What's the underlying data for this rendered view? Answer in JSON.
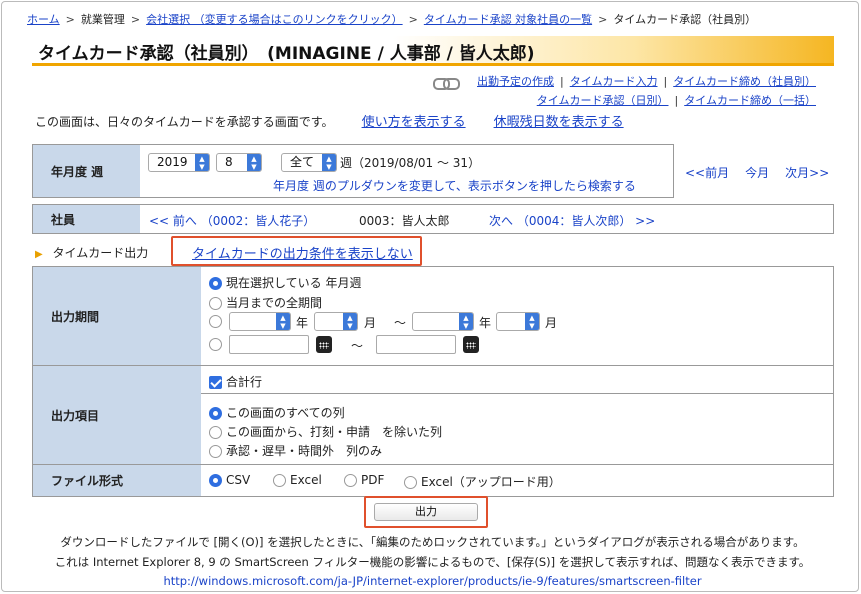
{
  "breadcrumb": {
    "home": "ホーム",
    "work": "就業管理",
    "company": "会社選択 （変更する場合はこのリンクをクリック）",
    "approval_list": "タイムカード承認 対象社員の一覧",
    "current": "タイムカード承認（社員別）"
  },
  "title": "タイムカード承認（社員別）　(MINAGINE / 人事部 / 皆人太郎)",
  "top_links": {
    "row1": [
      "出勤予定の作成",
      "タイムカード入力",
      "タイムカード締め（社員別）"
    ],
    "row2": [
      "タイムカード承認（日別）",
      "タイムカード締め（一括）"
    ]
  },
  "intro": {
    "text": "この画面は、日々のタイムカードを承認する画面です。",
    "how_to": "使い方を表示する",
    "leave": "休暇残日数を表示する"
  },
  "period": {
    "label": "年月度 週",
    "year": "2019",
    "month": "8",
    "week": "全て",
    "week_suffix": "週（2019/08/01 〜 31）",
    "hint": "年月度 週のプルダウンを変更して、表示ボタンを押したら検索する",
    "prev_month": "<<前月",
    "this_month": "今月",
    "next_month": "次月>>"
  },
  "employee": {
    "label": "社員",
    "prev": "<< 前へ （0002：皆人花子）",
    "current": "0003：皆人太郎",
    "next": "次へ （0004：皆人次郎） >>"
  },
  "output_section": {
    "label": "タイムカード出力",
    "toggle_link": "タイムカードの出力条件を表示しない"
  },
  "output_period": {
    "label": "出力期間",
    "options": [
      "現在選択している 年月週",
      "当月までの全期間"
    ],
    "year_unit": "年",
    "month_unit": "月",
    "range_sep": "〜"
  },
  "output_items": {
    "label": "出力項目",
    "total_row": "合計行",
    "options": [
      "この画面のすべての列",
      "この画面から、打刻・申請　を除いた列",
      "承認・遅早・時間外　列のみ"
    ]
  },
  "file_format": {
    "label": "ファイル形式",
    "options": [
      "CSV",
      "Excel",
      "PDF",
      "Excel（アップロード用）"
    ]
  },
  "output_button": "出力",
  "footer": {
    "line1": "ダウンロードしたファイルで [開く(O)] を選択したときに、「編集のためロックされています。」というダイアログが表示される場合があります。",
    "line2": "これは Internet Explorer 8, 9 の SmartScreen フィルター機能の影響によるもので、[保存(S)] を選択して表示すれば、問題なく表示できます。",
    "url": "http://windows.microsoft.com/ja-JP/internet-explorer/products/ie-9/features/smartscreen-filter"
  },
  "colors": {
    "label_bg": "#c9d8ea",
    "accent_orange": "#f0a500",
    "link": "#1a43c8",
    "highlight_red": "#e0502c",
    "select_blue": "#3c79d9"
  }
}
